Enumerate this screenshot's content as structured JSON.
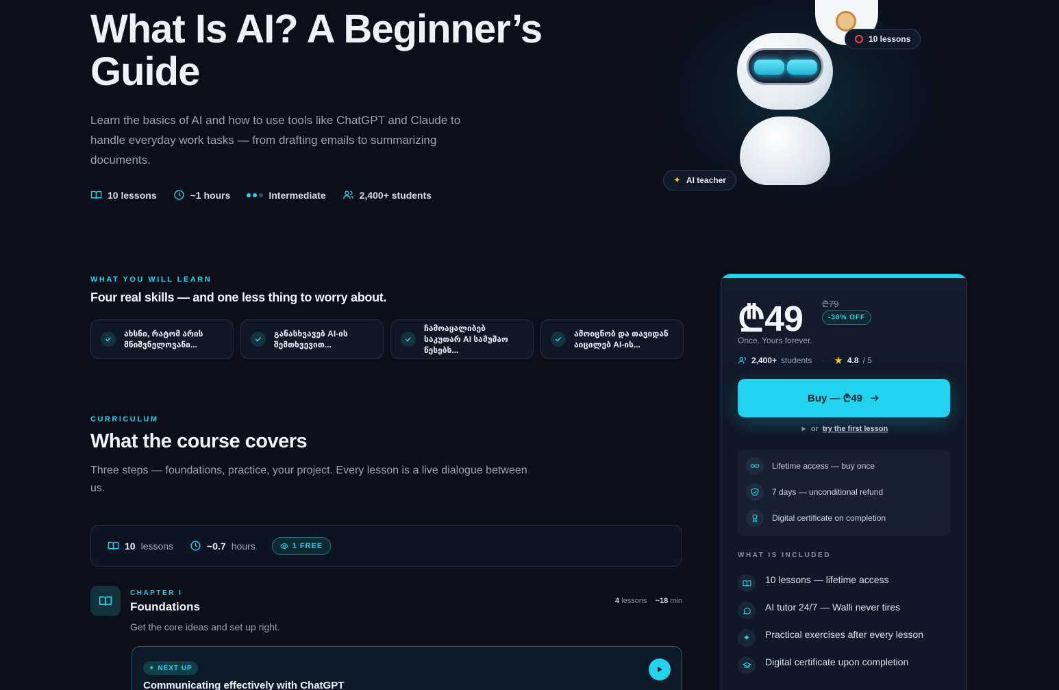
{
  "hero": {
    "title": "What Is AI? A Beginner’s Guide",
    "subtitle": "Learn the basics of AI and how to use tools like ChatGPT and Claude to handle everyday work tasks — from drafting emails to summarizing documents.",
    "meta": {
      "lessons": "10 lessons",
      "hours": "~1 hours",
      "level": "Intermediate",
      "students": "2,400+ students"
    },
    "badges": {
      "lessons": "10 lessons",
      "teacher": "AI teacher"
    }
  },
  "learn": {
    "eyebrow": "WHAT YOU WILL LEARN",
    "heading": "Four real skills — and one less thing to worry about.",
    "skills": [
      "ახსნი, რატომ არის მნიშვნელოვანი...",
      "განასხვავებ AI-ის შემთხვევით...",
      "ჩამოაყალიბებ საკუთარ AI სამუშაო წესებს...",
      "ამოიცნობ და თავიდან აიცილებ AI-ის..."
    ]
  },
  "curriculum": {
    "eyebrow": "CURRICULUM",
    "heading": "What the course covers",
    "subtitle": "Three steps — foundations, practice, your project. Every lesson is a live dialogue between us.",
    "stats": {
      "lessons_count": "10",
      "lessons_label": "lessons",
      "hours_count": "~0.7",
      "hours_label": "hours",
      "free_badge": "1 FREE"
    },
    "chapter": {
      "label": "CHAPTER I",
      "title": "Foundations",
      "subtitle": "Get the core ideas and set up right.",
      "lessons_count": "4",
      "lessons_label": "lessons",
      "duration": "~18",
      "duration_unit": "min"
    },
    "next_up": {
      "badge": "NEXT UP",
      "title": "Communicating effectively with ChatGPT"
    }
  },
  "pricing": {
    "price": "₾49",
    "old_price": "₾79",
    "discount": "-38% OFF",
    "forever": "Once. Yours forever.",
    "students": "2,400+",
    "students_label": "students",
    "rating": "4.8",
    "rating_max": "/ 5",
    "buy_label": "Buy — ₾49",
    "try_prefix": "or",
    "try_link": "try the first lesson",
    "guarantees": [
      "Lifetime access — buy once",
      "7 days — unconditional refund",
      "Digital certificate on completion"
    ],
    "included_label": "WHAT IS INCLUDED",
    "included": [
      "10 lessons — lifetime access",
      "AI tutor 24/7 — Walli never tires",
      "Practical exercises after every lesson",
      "Digital certificate upon completion"
    ]
  },
  "colors": {
    "accent": "#22d3ee",
    "background": "#0c0f1a",
    "card": "#121726"
  }
}
